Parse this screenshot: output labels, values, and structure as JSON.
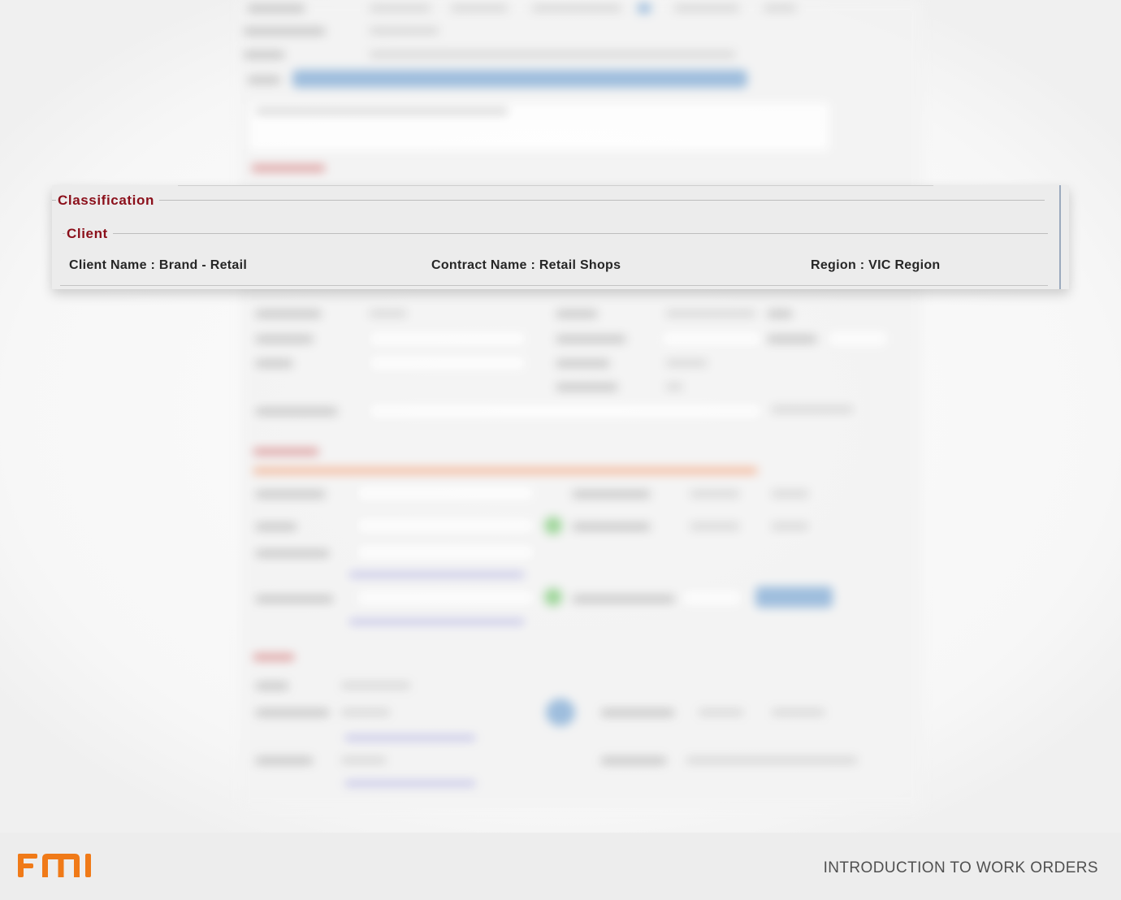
{
  "classification": {
    "legend": "Classification",
    "client_section": {
      "legend": "Client",
      "client_name": "Client Name : Brand - Retail",
      "contract_name": "Contract Name : Retail Shops",
      "region": "Region : VIC Region"
    }
  },
  "footer": {
    "logo_text": "FMI",
    "title": "INTRODUCTION TO WORK ORDERS"
  },
  "colors": {
    "legend_red": "#8b0f1a",
    "logo_orange": "#f07a18",
    "footer_bg": "#ededed"
  }
}
